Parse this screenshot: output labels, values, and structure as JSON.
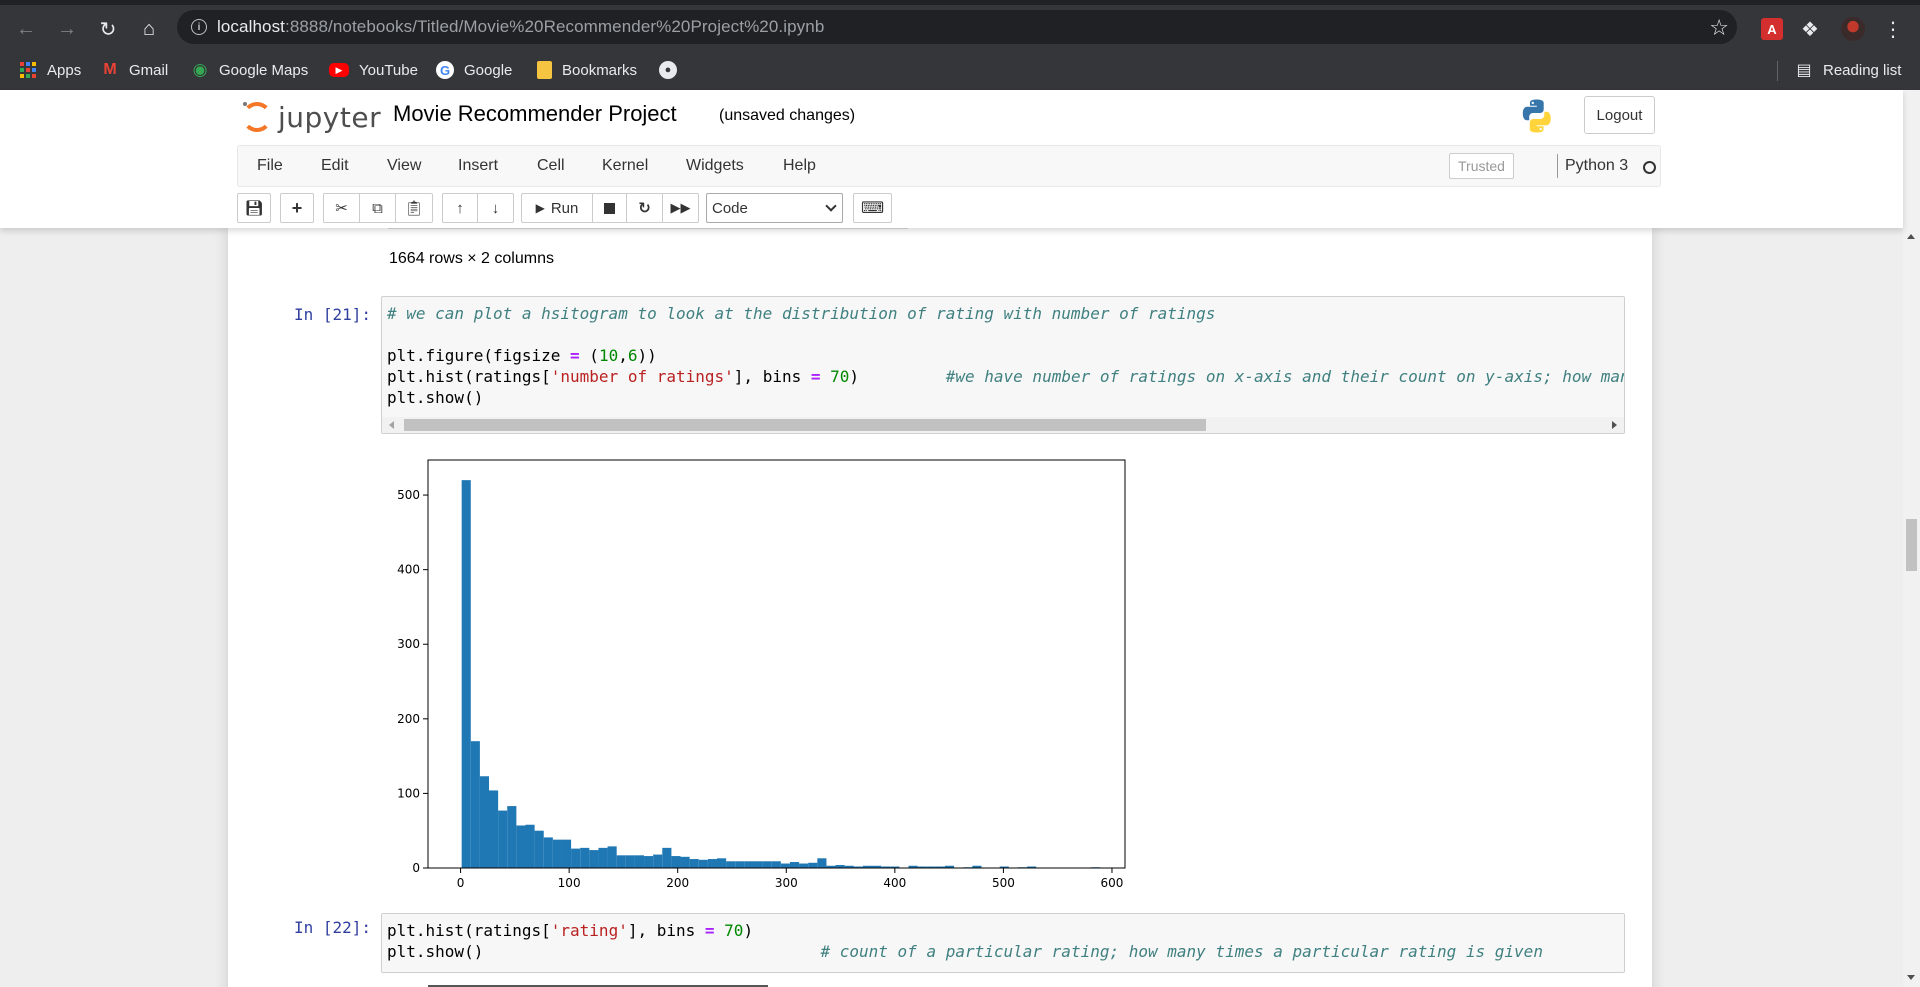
{
  "browser": {
    "url_host": "localhost",
    "url_path": ":8888/notebooks/Titled/Movie%20Recommender%20Project%20.ipynb",
    "bookmarks": [
      {
        "label": "Apps",
        "icon": "apps-grid-icon"
      },
      {
        "label": "Gmail",
        "icon": "gmail-icon"
      },
      {
        "label": "Google Maps",
        "icon": "google-maps-icon"
      },
      {
        "label": "YouTube",
        "icon": "youtube-icon"
      },
      {
        "label": "Google",
        "icon": "google-icon"
      },
      {
        "label": "Bookmarks",
        "icon": "folder-icon"
      },
      {
        "label": "",
        "icon": "github-icon"
      }
    ],
    "reading_list": "Reading list"
  },
  "jupyter": {
    "logo_text": "jupyter",
    "notebook_title": "Movie Recommender Project",
    "save_status": "(unsaved changes)",
    "logout": "Logout",
    "menu": [
      "File",
      "Edit",
      "View",
      "Insert",
      "Cell",
      "Kernel",
      "Widgets",
      "Help"
    ],
    "trusted": "Trusted",
    "kernel": "Python 3",
    "toolbar": {
      "run_label": "Run",
      "cell_type": "Code"
    }
  },
  "notebook": {
    "df_summary": "1664 rows × 2 columns",
    "cells": [
      {
        "prompt": "In [21]:",
        "lines": [
          "# we can plot a hsitogram to look at the distribution of rating with number of ratings",
          "",
          "plt.figure(figsize = (10,6))",
          "plt.hist(ratings['number of ratings'], bins = 70)         #we have number of ratings on x-axis and their count on y-axis; how man",
          "plt.show()"
        ]
      },
      {
        "prompt": "In [22]:",
        "lines": [
          "plt.hist(ratings['rating'], bins = 70)",
          "plt.show()                                   # count of a particular rating; how many times a particular rating is given"
        ]
      }
    ]
  },
  "colors": {
    "bar": "#1f77b4",
    "jupyter_orange": "#f37726",
    "prompt_blue": "#303f9f",
    "comment": "#408080",
    "string": "#ba2121",
    "number": "#008800",
    "operator": "#aa22ff"
  },
  "chart_data": {
    "type": "bar",
    "xlabel": "",
    "ylabel": "",
    "xlim": [
      -30,
      612
    ],
    "ylim": [
      0,
      547
    ],
    "xticks": [
      0,
      100,
      200,
      300,
      400,
      500,
      600
    ],
    "yticks": [
      0,
      100,
      200,
      300,
      400,
      500
    ],
    "bin_start": 1,
    "bin_width": 8.4,
    "values": [
      520,
      170,
      123,
      104,
      77,
      83,
      57,
      58,
      50,
      41,
      38,
      38,
      26,
      27,
      24,
      27,
      29,
      17,
      17,
      17,
      16,
      18,
      27,
      16,
      15,
      12,
      11,
      12,
      13,
      9,
      9,
      9,
      9,
      9,
      9,
      6,
      8,
      6,
      7,
      13,
      3,
      4,
      3,
      2,
      3,
      3,
      2,
      2,
      0,
      3,
      2,
      2,
      2,
      3,
      0,
      1,
      3,
      0,
      0,
      2,
      0,
      1,
      2,
      0,
      0,
      0,
      0,
      0,
      0,
      1
    ]
  }
}
